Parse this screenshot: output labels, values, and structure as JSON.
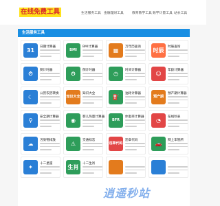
{
  "header": {
    "logo_text": "在线免费工具",
    "nav": [
      "生活服务工具",
      "金融理财工具",
      "教育教学工具",
      "数学计量工具",
      "站长工具"
    ]
  },
  "section": {
    "title": "生活服务工具"
  },
  "cards": [
    {
      "title": "日期计算器",
      "icon_color": "#2a7fd6",
      "icon": "calendar-icon",
      "glyph": "31",
      "glyph_small": false
    },
    {
      "title": "BMI计算器",
      "icon_color": "#2e9d5a",
      "icon": "bmi-icon",
      "glyph": "BMI",
      "glyph_small": true
    },
    {
      "title": "万年历查询",
      "icon_color": "#e37b1d",
      "icon": "calendar-book-icon",
      "glyph": "▦",
      "glyph_small": false
    },
    {
      "title": "时辰查询",
      "icon_color": "#ff7043",
      "icon": "time-period-icon",
      "glyph": "时辰",
      "glyph_small": false
    },
    {
      "title": "倒计时器",
      "icon_color": "#2a7fd6",
      "icon": "stopwatch-icon",
      "glyph": "⏱",
      "glyph_small": false
    },
    {
      "title": "倒计时器",
      "icon_color": "#2e9d5a",
      "icon": "timer-icon",
      "glyph": "⏲",
      "glyph_small": false
    },
    {
      "title": "时间计算器",
      "icon_color": "#2e9d5a",
      "icon": "clock-icon",
      "glyph": "◷",
      "glyph_small": false
    },
    {
      "title": "年龄计算器",
      "icon_color": "#e24646",
      "icon": "age-icon",
      "glyph": "☺",
      "glyph_small": false
    },
    {
      "title": "公历农历转换",
      "icon_color": "#2a7fd6",
      "icon": "lunar-calendar-icon",
      "glyph": "☾",
      "glyph_small": false
    },
    {
      "title": "知识大全",
      "icon_color": "#e37b1d",
      "icon": "knowledge-icon",
      "glyph": "知识大全",
      "glyph_small": true
    },
    {
      "title": "油耗计算器",
      "icon_color": "#2e9d5a",
      "icon": "fuel-icon",
      "glyph": "⛽",
      "glyph_small": false
    },
    {
      "title": "预产期计算器",
      "icon_color": "#e37b1d",
      "icon": "due-date-icon",
      "glyph": "预产期",
      "glyph_small": true
    },
    {
      "title": "安全期计算器",
      "icon_color": "#2a7fd6",
      "icon": "safe-period-icon",
      "glyph": "♀",
      "glyph_small": false
    },
    {
      "title": "婴儿热量计算器",
      "icon_color": "#2e9d5a",
      "icon": "baby-icon",
      "glyph": "◉",
      "glyph_small": false
    },
    {
      "title": "体脂率计算器",
      "icon_color": "#2e9d5a",
      "icon": "body-fat-icon",
      "glyph": "BFR",
      "glyph_small": true
    },
    {
      "title": "在线秒表",
      "icon_color": "#e24646",
      "icon": "online-stopwatch-icon",
      "glyph": "◔",
      "glyph_small": false
    },
    {
      "title": "污染物排放",
      "icon_color": "#2a7fd6",
      "icon": "pollution-icon",
      "glyph": "☁",
      "glyph_small": false
    },
    {
      "title": "交通标志",
      "icon_color": "#2e9d5a",
      "icon": "traffic-sign-icon",
      "glyph": "⚠",
      "glyph_small": false
    },
    {
      "title": "违章代码",
      "icon_color": "#e24646",
      "icon": "violation-code-icon",
      "glyph": "违章代码",
      "glyph_small": true
    },
    {
      "title": "网上车管所",
      "icon_color": "#2e9d5a",
      "icon": "vehicle-office-icon",
      "glyph": "🚗",
      "glyph_small": false
    },
    {
      "title": "十二星座",
      "icon_color": "#2a7fd6",
      "icon": "zodiac-icon",
      "glyph": "✦",
      "glyph_small": false
    },
    {
      "title": "十二生肖",
      "icon_color": "#2e9d5a",
      "icon": "chinese-zodiac-icon",
      "glyph": "生肖",
      "glyph_small": false
    },
    {
      "title": "",
      "icon_color": "#e37b1d",
      "icon": "misc-icon",
      "glyph": "",
      "glyph_small": false
    },
    {
      "title": "",
      "icon_color": "#2a7fd6",
      "icon": "misc-icon-2",
      "glyph": "",
      "glyph_small": false
    }
  ],
  "watermark": "逍遥秒站"
}
